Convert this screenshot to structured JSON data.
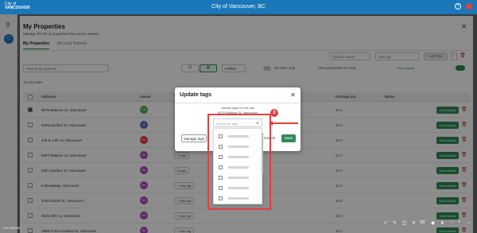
{
  "app": {
    "logo_line1": "City of",
    "logo_line2": "VANCOUVER",
    "title": "City of Vancouver, BC"
  },
  "colors": {
    "brand_blue": "#1a78b8",
    "accent_green": "#2e8b57",
    "annotation_red": "#e04040"
  },
  "panel": {
    "title": "My Properties",
    "subtitle": "Manage the list of properties that you've viewed",
    "tabs": [
      {
        "label": "My Properties",
        "active": true
      },
      {
        "label": "All Local Reports",
        "active": false
      }
    ],
    "update_owner_placeholder": "Update owner",
    "add_tag_placeholder": "Add tag",
    "add_filter_label": "Add filter",
    "search_placeholder": "Search an address",
    "filter_label": "Filter",
    "my_sites_only_label": "My sites only",
    "view_on_map_label": "View properties on map",
    "show_layout_label": "Show layout",
    "count_text": "10-123 sites"
  },
  "table": {
    "headers": {
      "address": "Address",
      "owner": "Owner",
      "tags": "Ta",
      "footage": "Footage (m)",
      "notes": "Notes"
    },
    "rows": [
      {
        "address": "6075 Battison St, Vancouver",
        "initials": "LN",
        "color": "#4caf50",
        "tag": "",
        "footage": "10.1"
      },
      {
        "address": "6339 Quebec St, Vancouver",
        "initials": "JP",
        "color": "#5b6abf",
        "tag": "",
        "footage": "10.0"
      },
      {
        "address": "446 E 44th Av, Vancouver",
        "initials": "BG",
        "color": "#e53935",
        "tag": "",
        "footage": "10.0"
      },
      {
        "address": "6087 Battison St, Vancouver",
        "initials": "BA",
        "color": "#ab47bc",
        "tag": "3 tags",
        "footage": "13.4"
      },
      {
        "address": "6321 Quebec St, Vancouver",
        "initials": "BA",
        "color": "#ab47bc",
        "tag": "8 tags",
        "footage": "10.1"
      },
      {
        "address": "E Broadway, Vancouver",
        "initials": "BA",
        "color": "#ab47bc",
        "tag": "+ Add tag",
        "footage": "10.0"
      },
      {
        "address": "3782 Dobell St, Vancouver",
        "initials": "BA",
        "color": "#ab47bc",
        "tag": "+ Add tag",
        "footage": "24.5"
      },
      {
        "address": "3515 43th Av, Vancouver",
        "initials": "BA",
        "color": "#ab47bc",
        "tag": "+ Add tag",
        "footage": "10.2"
      },
      {
        "address": "2969 Prince Edward St, Vancouver",
        "initials": "BA",
        "color": "#ab47bc",
        "tag": "+ Add tag",
        "footage": "10.1"
      }
    ],
    "view_details_label": "View details"
  },
  "modal": {
    "title": "Update tags",
    "desc_line1": "Update tags for this site",
    "desc_line2": "6075 Battison St, Vancouver",
    "search_placeholder": "Search for tags",
    "manage_tags_label": "Manage tags",
    "cancel_label": "Cancel",
    "save_label": "Save",
    "tag_count": 7
  },
  "annotation": {
    "step_number": "2"
  },
  "map_controls": {
    "zoom_text": "3D"
  },
  "scale_text": "0 ● 1m/2000"
}
